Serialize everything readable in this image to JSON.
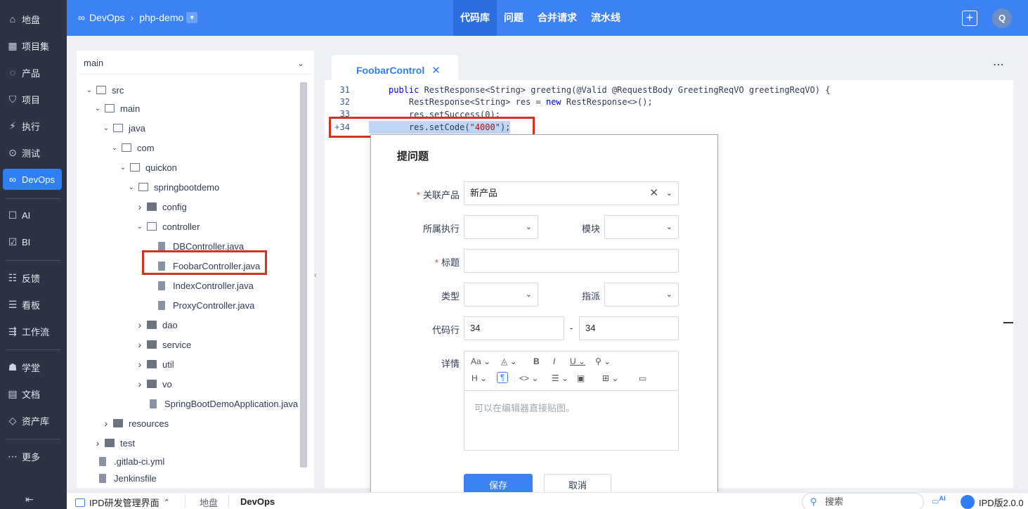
{
  "nav": {
    "items": [
      {
        "label": "地盘",
        "icon": "home-icon"
      },
      {
        "label": "项目集",
        "icon": "grid-icon"
      },
      {
        "label": "产品",
        "icon": "bulb-icon"
      },
      {
        "label": "项目",
        "icon": "project-icon"
      },
      {
        "label": "执行",
        "icon": "run-icon"
      },
      {
        "label": "测试",
        "icon": "test-icon"
      },
      {
        "label": "DevOps",
        "icon": "infinity-icon"
      },
      {
        "label": "AI",
        "icon": "robot-icon"
      },
      {
        "label": "BI",
        "icon": "chart-icon"
      },
      {
        "label": "反馈",
        "icon": "feedback-icon"
      },
      {
        "label": "看板",
        "icon": "kanban-icon"
      },
      {
        "label": "工作流",
        "icon": "workflow-icon"
      },
      {
        "label": "学堂",
        "icon": "school-icon"
      },
      {
        "label": "文档",
        "icon": "doc-icon"
      },
      {
        "label": "资产库",
        "icon": "diamond-icon"
      },
      {
        "label": "更多",
        "icon": "more-icon"
      }
    ],
    "active": "DevOps"
  },
  "header": {
    "crumb_root": "DevOps",
    "crumb_repo": "php-demo",
    "tabs": [
      "代码库",
      "问题",
      "合并请求",
      "流水线"
    ],
    "active_tab": "代码库",
    "avatar": "Q"
  },
  "tree": {
    "branch": "main",
    "rows": [
      {
        "label": "src",
        "type": "open"
      },
      {
        "label": "main",
        "type": "open"
      },
      {
        "label": "java",
        "type": "open"
      },
      {
        "label": "com",
        "type": "open"
      },
      {
        "label": "quickon",
        "type": "open"
      },
      {
        "label": "springbootdemo",
        "type": "open"
      },
      {
        "label": "config",
        "type": "closed"
      },
      {
        "label": "controller",
        "type": "open"
      },
      {
        "label": "DBController.java",
        "type": "file"
      },
      {
        "label": "FoobarController.java",
        "type": "file"
      },
      {
        "label": "IndexController.java",
        "type": "file"
      },
      {
        "label": "ProxyController.java",
        "type": "file"
      },
      {
        "label": "dao",
        "type": "closed"
      },
      {
        "label": "service",
        "type": "closed"
      },
      {
        "label": "util",
        "type": "closed"
      },
      {
        "label": "vo",
        "type": "closed"
      },
      {
        "label": "SpringBootDemoApplication.java",
        "type": "file"
      },
      {
        "label": "resources",
        "type": "closed"
      },
      {
        "label": "test",
        "type": "closed"
      },
      {
        "label": ".gitlab-ci.yml",
        "type": "file"
      },
      {
        "label": "Jenkinsfile",
        "type": "file"
      }
    ]
  },
  "editor": {
    "tab_label": "FoobarControl",
    "line_numbers": [
      "31",
      "32",
      "33",
      "34"
    ],
    "code": {
      "l31_kw": "public",
      "l31_rest": " RestResponse<String> greeting(@Valid @RequestBody GreetingReqVO greetingReqVO) {",
      "l32_a": "    RestResponse<String> res = ",
      "l32_kw": "new",
      "l32_b": " RestResponse<>();",
      "l33": "    res.setSuccess(0);",
      "l34_a": "    res.setCode(",
      "l34_str": "\"4000\"",
      "l34_b": ");"
    }
  },
  "modal": {
    "title": "提问题",
    "fields": {
      "product_label": "关联产品",
      "product_value": "新产品",
      "execution_label": "所属执行",
      "module_label": "模块",
      "title_label": "标题",
      "type_label": "类型",
      "assign_label": "指派",
      "lines_label": "代码行",
      "line_from": "34",
      "line_dash": "-",
      "line_to": "34",
      "detail_label": "详情"
    },
    "editor_placeholder": "可以在编辑器直接贴图。",
    "save": "保存",
    "cancel": "取消"
  },
  "bottombar": {
    "app": "IPD研发管理界面",
    "crumb1": "地盘",
    "crumb2": "DevOps",
    "search": "搜索",
    "ai": "AI",
    "version": "IPD版2.0.0"
  }
}
